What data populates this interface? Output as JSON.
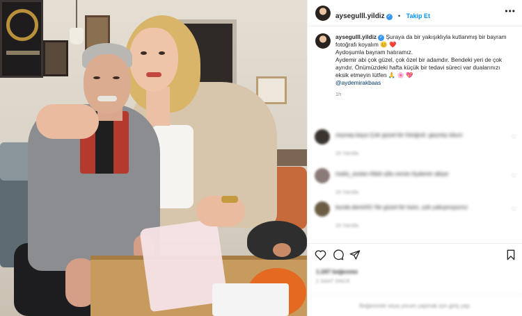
{
  "header": {
    "username": "aysegulll.yildiz",
    "verified_mark": "✓",
    "separator": "•",
    "follow_label": "Takip Et",
    "more_icon": "more-horizontal-icon"
  },
  "caption": {
    "username": "aysegulll.yildiz",
    "lines": [
      "Şuraya da bir yakışıklıyla kutlanmış bir bayram",
      "fotoğrafı koyalım 😊 ❤️",
      "Aydoşumla bayram hatıramız.",
      "Aydemir abi çok güzel, çok özel bir adamdır. Bendeki yeri de çok",
      "ayrıdır. Önümüzdeki hafta küçük bir tedavi süreci var dualarınızı",
      "eksik etmeyin lütfen 🙏 🌸 💖"
    ],
    "mention": "@aydemirakbaas",
    "time": "1h"
  },
  "comments": [
    {
      "avatar_color": "#3a3430",
      "text": "zeynep.kaya Çok güzel bir fotoğraf, geçmiş olsun",
      "meta": "1h   Yanıtla"
    },
    {
      "avatar_color": "#8a7a78",
      "text": "melis_arslan Allah şifa versin Aydemir abiye",
      "meta": "1h   Yanıtla"
    },
    {
      "avatar_color": "#6a5d44",
      "text": "burak.demir61 Ne güzel bir kare, çok yakışmışsınız",
      "meta": "1h   Yanıtla"
    }
  ],
  "actions": {
    "like_icon": "heart-icon",
    "comment_icon": "comment-icon",
    "share_icon": "share-icon",
    "save_icon": "bookmark-icon"
  },
  "likes_text": "1.247 beğenme",
  "post_date": "2 SAAT ÖNCE",
  "login_prompt": "Beğenmek veya yorum yapmak için giriş yap."
}
